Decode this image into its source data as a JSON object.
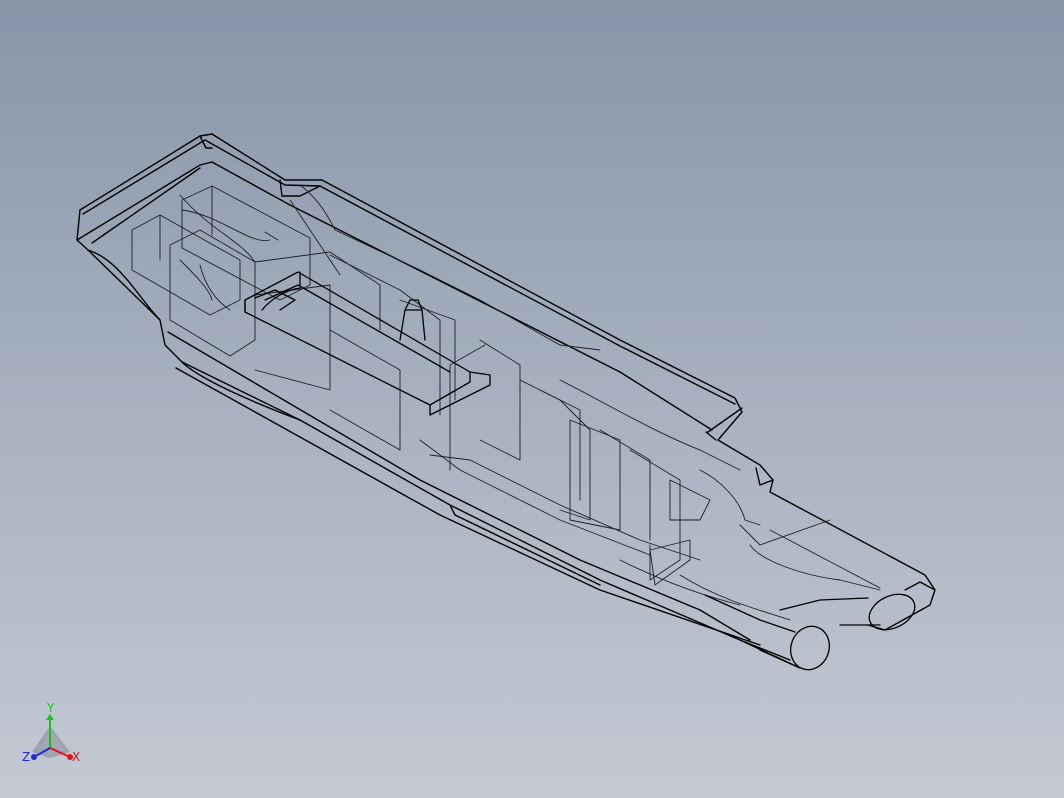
{
  "view": {
    "background_top": "#8795a8",
    "background_bottom": "#c4c9d3",
    "edge_color": "#000000"
  },
  "triad": {
    "x_label": "X",
    "y_label": "Y",
    "z_label": "Z",
    "x_color": "#e0141e",
    "y_color": "#18c418",
    "z_color": "#1c2cd8"
  }
}
